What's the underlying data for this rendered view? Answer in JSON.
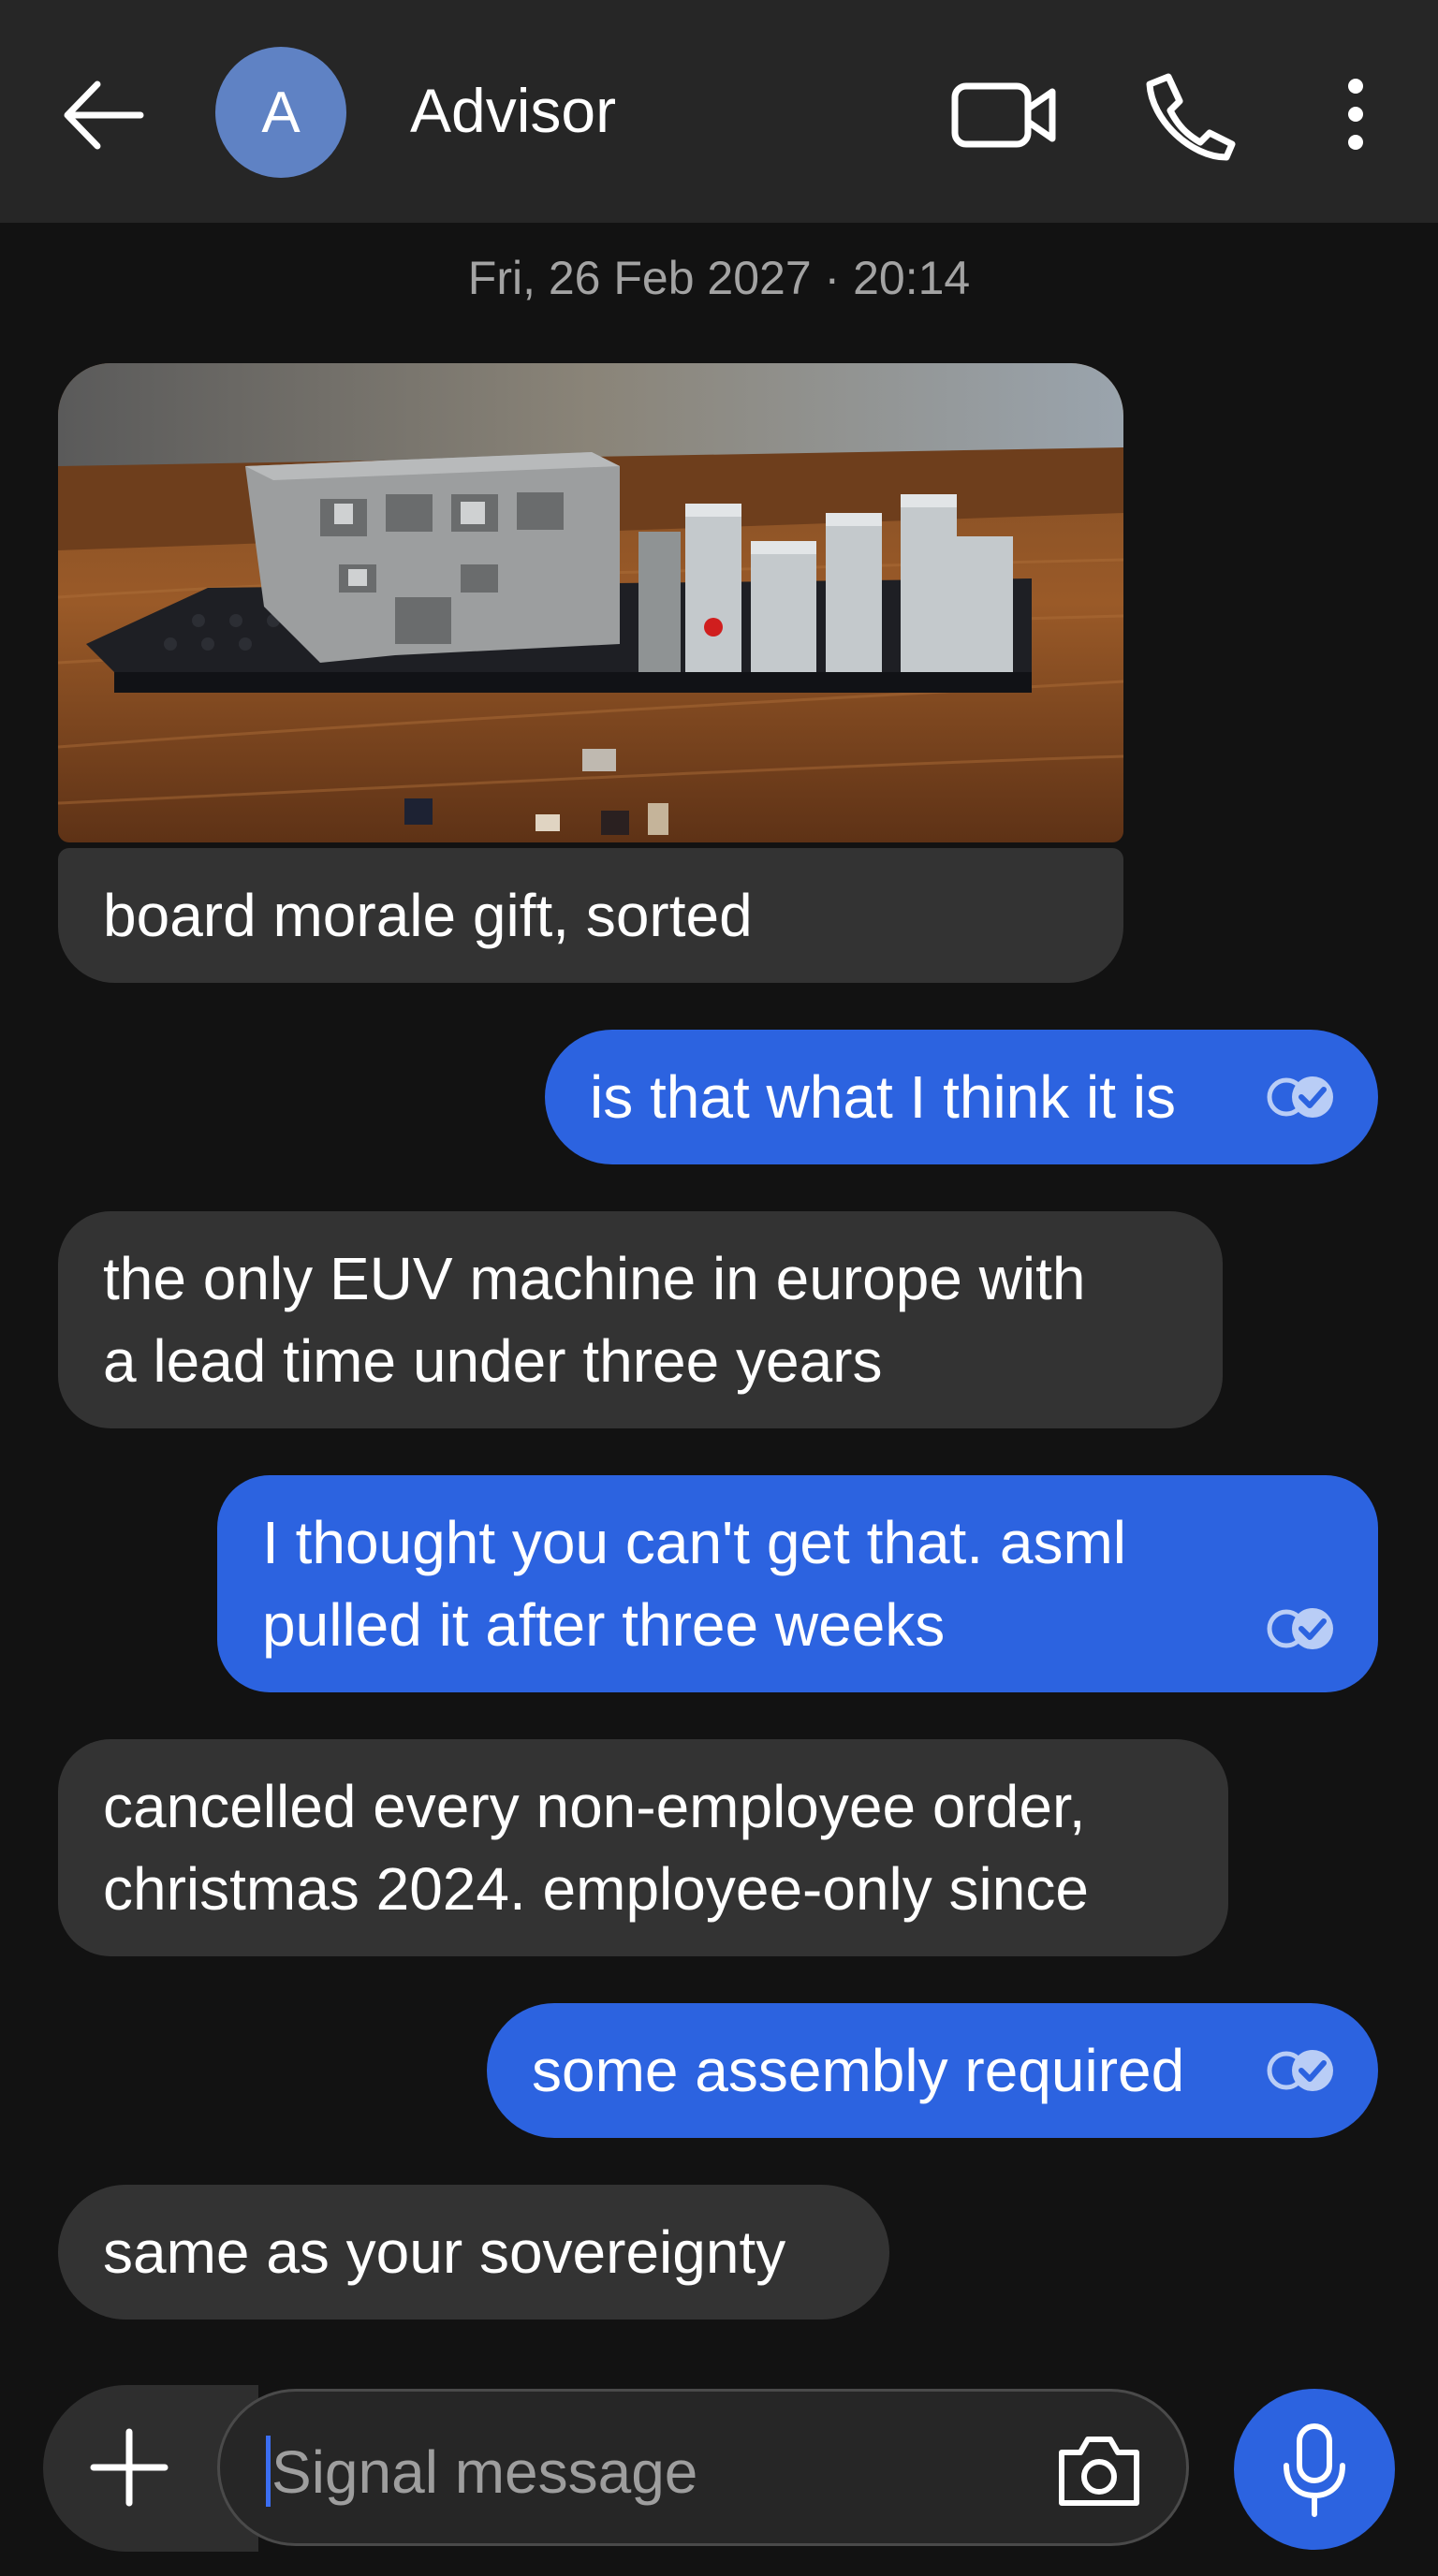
{
  "header": {
    "avatar_initial": "A",
    "contact_name": "Advisor",
    "icons": [
      "back-arrow-icon",
      "video-call-icon",
      "phone-icon",
      "more-vert-icon"
    ]
  },
  "conversation": {
    "date_separator": "Fri, 26 Feb 2027 · 20:14",
    "messages": [
      {
        "direction": "incoming",
        "type": "image",
        "image_subject": "grey brick model of a machine on a dark baseplate on a wooden table",
        "caption": "board morale gift, sorted"
      },
      {
        "direction": "outgoing",
        "text": "is that what I think it is",
        "status": "read"
      },
      {
        "direction": "incoming",
        "lines": [
          "the only EUV machine in europe with",
          "a lead time under three years"
        ]
      },
      {
        "direction": "outgoing",
        "lines": [
          "I thought you can't get that. asml",
          "pulled it after three weeks"
        ],
        "status": "read"
      },
      {
        "direction": "incoming",
        "lines": [
          "cancelled every non-employee order,",
          "christmas 2024. employee-only since"
        ]
      },
      {
        "direction": "outgoing",
        "text": "some assembly required",
        "status": "read"
      },
      {
        "direction": "incoming",
        "text": "same as your sovereignty"
      }
    ]
  },
  "composer": {
    "placeholder": "Signal message",
    "icons": [
      "plus-icon",
      "camera-icon",
      "mic-icon"
    ]
  },
  "colors": {
    "background": "#121212",
    "header": "#262626",
    "incoming_bubble": "#333333",
    "outgoing_bubble": "#2c63e0",
    "avatar": "#5f82c4"
  }
}
